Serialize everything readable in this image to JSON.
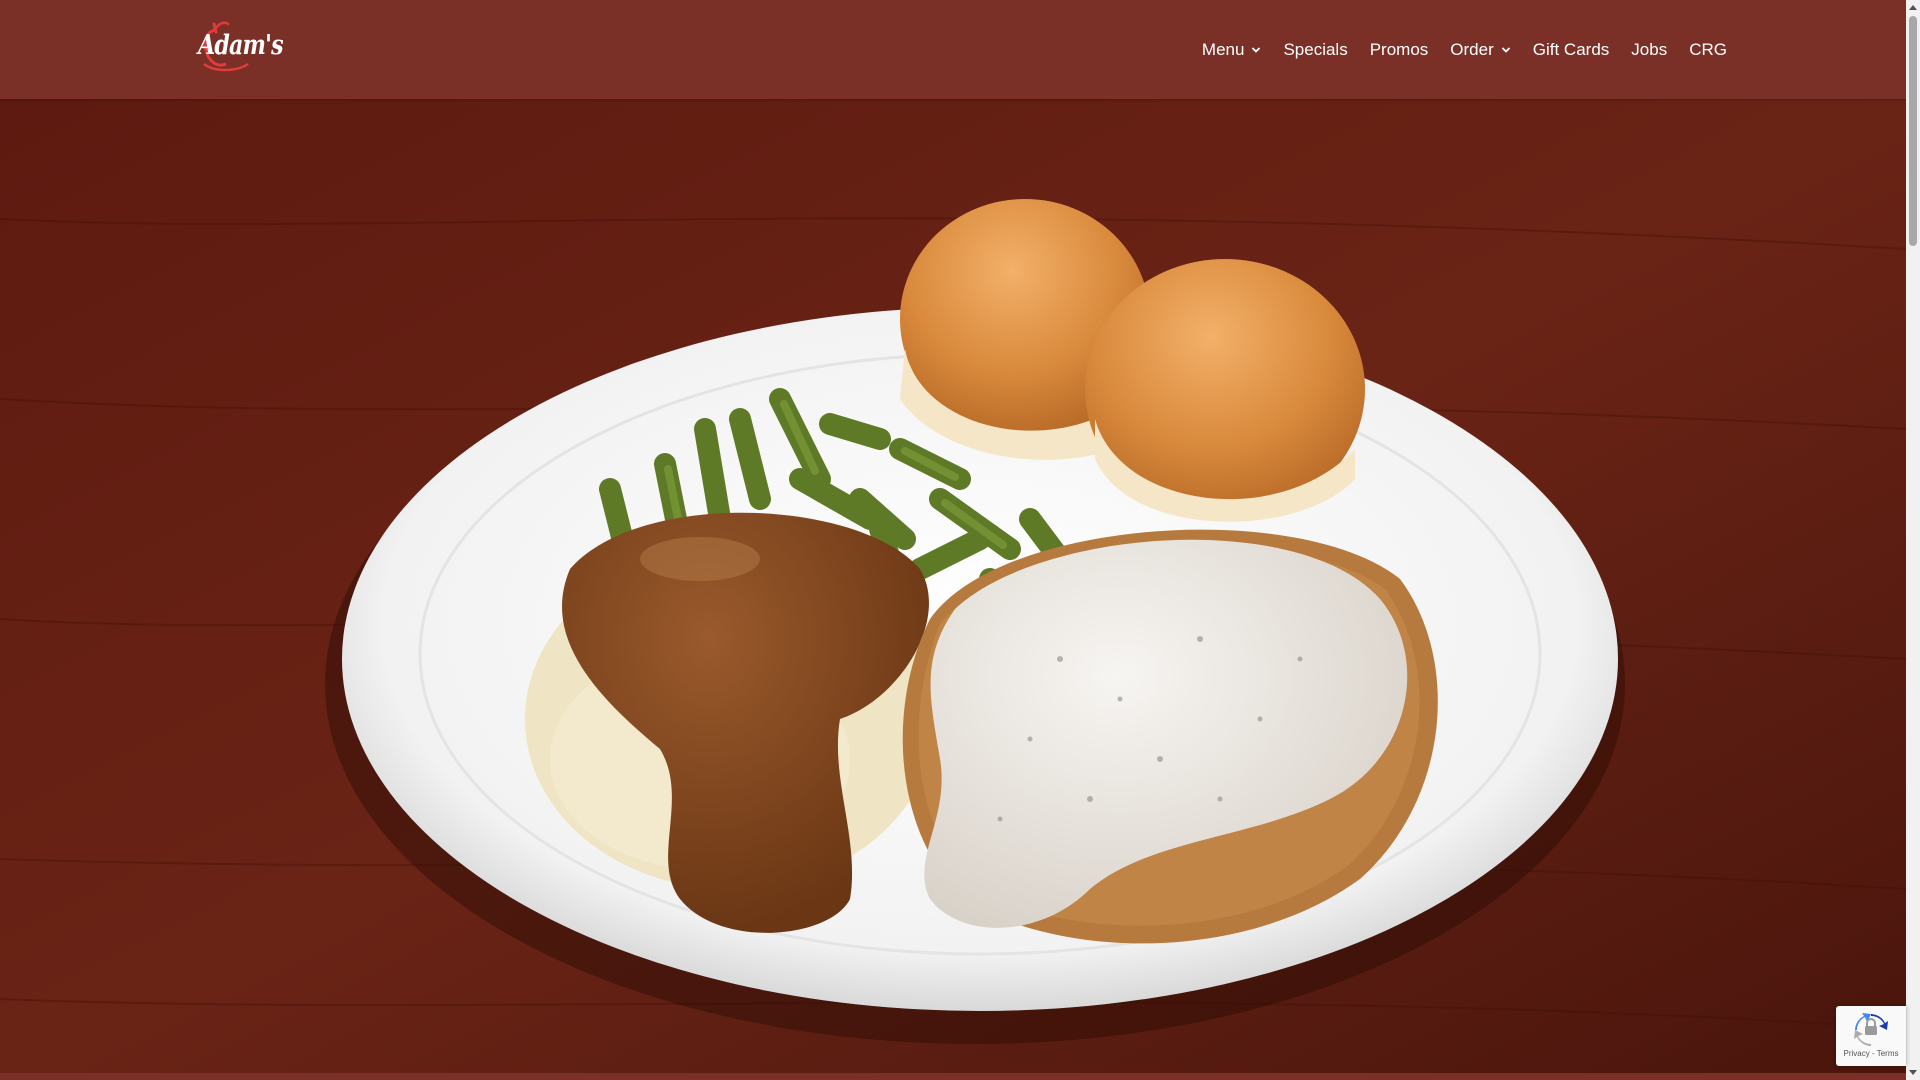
{
  "brand": {
    "logo_text": "Adam's",
    "accent_color": "#e23b3b",
    "header_color": "#7a3027"
  },
  "nav": {
    "items": [
      {
        "label": "Menu",
        "has_dropdown": true
      },
      {
        "label": "Specials",
        "has_dropdown": false
      },
      {
        "label": "Promos",
        "has_dropdown": false
      },
      {
        "label": "Order",
        "has_dropdown": true
      },
      {
        "label": "Gift Cards",
        "has_dropdown": false
      },
      {
        "label": "Jobs",
        "has_dropdown": false
      },
      {
        "label": "CRG",
        "has_dropdown": false
      }
    ]
  },
  "hero": {
    "image": "chicken-fried-steak-plate-photo"
  },
  "recaptcha": {
    "links_text": "Privacy - Terms",
    "icon": "recaptcha-icon"
  },
  "scrollbar": {
    "icon_up": "scroll-up-arrow-icon",
    "icon_down": "scroll-down-arrow-icon"
  }
}
